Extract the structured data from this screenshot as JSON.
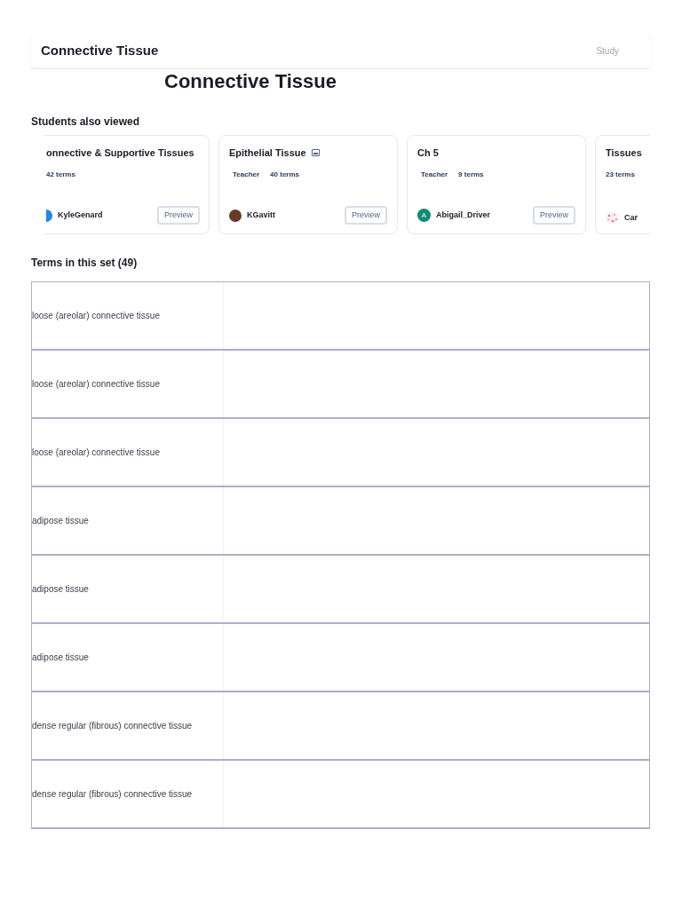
{
  "header": {
    "title": "Connective Tissue",
    "study_link": "Study"
  },
  "big_title": "Connective Tissue",
  "also_viewed": {
    "heading": "Students also viewed",
    "cards": [
      {
        "title": "onnective & Supportive Tissues",
        "terms": "42 terms",
        "author": "KyleGenard",
        "avatar": {
          "kind": "half"
        },
        "preview": "Preview"
      },
      {
        "title": "Epithelial Tissue",
        "badge": "Teacher",
        "has_image": true,
        "terms": "40 terms",
        "author": "KGavitt",
        "avatar": {
          "kind": "photo"
        },
        "preview": "Preview"
      },
      {
        "title": "Ch 5",
        "badge": "Teacher",
        "terms": "9 terms",
        "author": "Abigail_Driver",
        "avatar": {
          "kind": "letter",
          "letter": "A"
        },
        "preview": "Preview"
      },
      {
        "title": "Tissues",
        "terms": "23 terms",
        "author": "Car",
        "avatar": {
          "kind": "dots"
        }
      }
    ]
  },
  "terms": {
    "heading": "Terms in this set (49)",
    "rows": [
      {
        "term": "loose (areolar) connective tissue"
      },
      {
        "term": "loose (areolar) connective tissue"
      },
      {
        "term": "loose (areolar) connective tissue"
      },
      {
        "term": "adipose tissue"
      },
      {
        "term": "adipose tissue"
      },
      {
        "term": "adipose tissue"
      },
      {
        "term": "dense regular (fibrous) connective tissue"
      },
      {
        "term": "dense regular (fibrous) connective tissue"
      }
    ]
  }
}
